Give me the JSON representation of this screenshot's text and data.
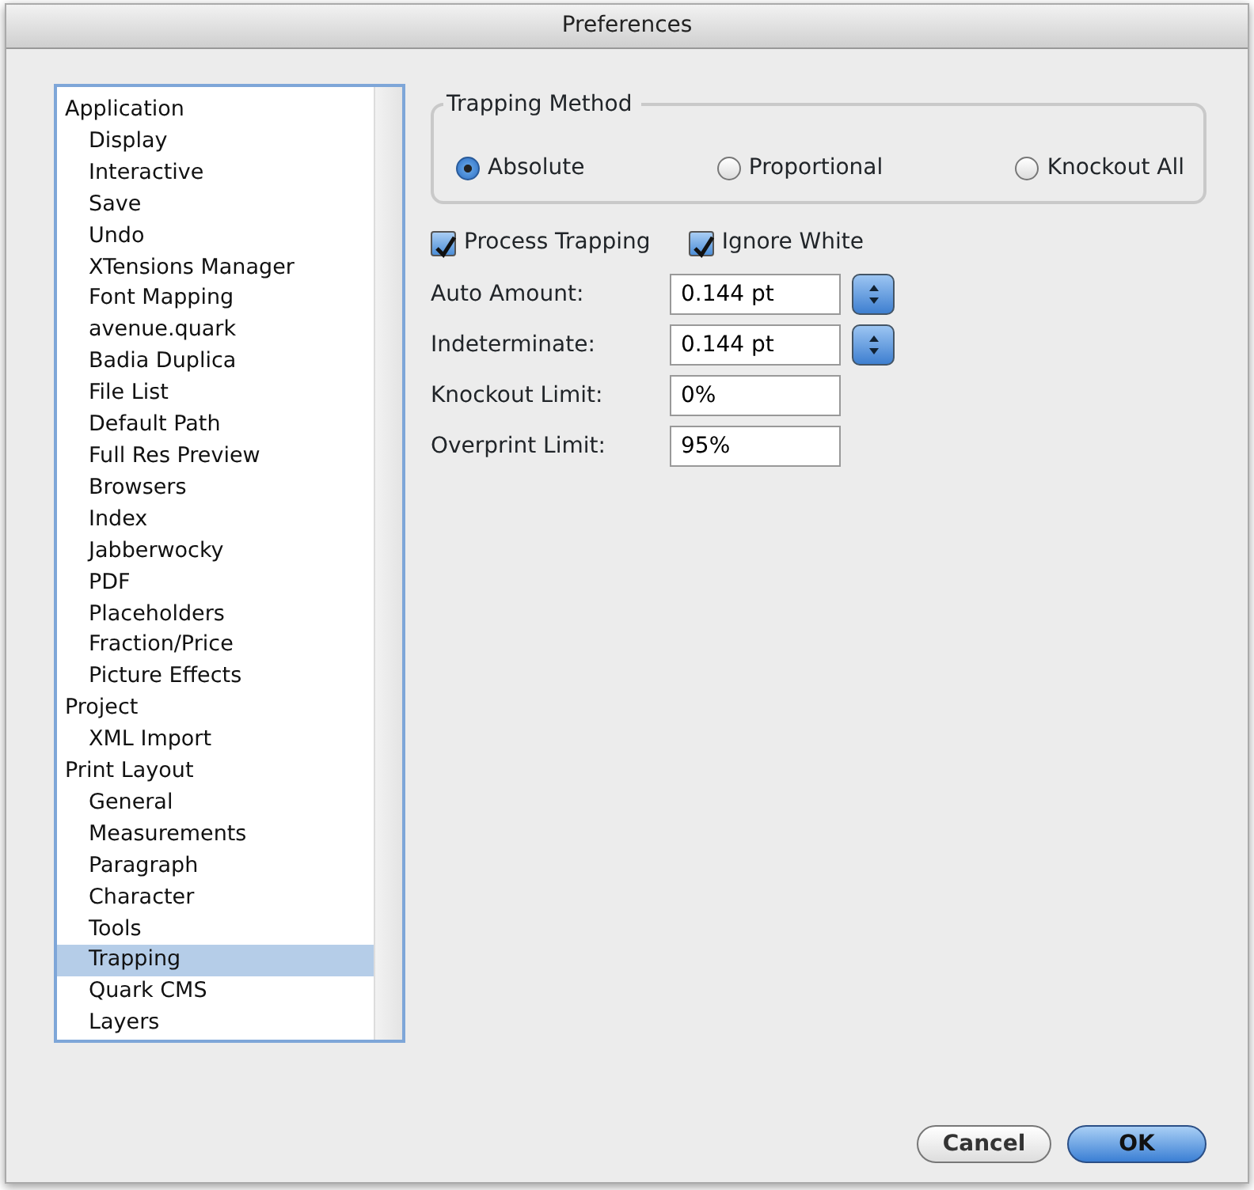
{
  "window": {
    "title": "Preferences"
  },
  "sidebar": {
    "items": [
      {
        "label": "Application",
        "selected": false,
        "children": [
          {
            "label": "Display",
            "selected": false
          },
          {
            "label": "Interactive",
            "selected": false
          },
          {
            "label": "Save",
            "selected": false
          },
          {
            "label": "Undo",
            "selected": false
          },
          {
            "label": "XTensions Manager",
            "selected": false
          },
          {
            "label": "Font Mapping",
            "selected": false
          },
          {
            "label": "avenue.quark",
            "selected": false
          },
          {
            "label": "Badia Duplica",
            "selected": false
          },
          {
            "label": "File List",
            "selected": false
          },
          {
            "label": "Default Path",
            "selected": false
          },
          {
            "label": "Full Res Preview",
            "selected": false
          },
          {
            "label": "Browsers",
            "selected": false
          },
          {
            "label": "Index",
            "selected": false
          },
          {
            "label": "Jabberwocky",
            "selected": false
          },
          {
            "label": "PDF",
            "selected": false
          },
          {
            "label": "Placeholders",
            "selected": false
          },
          {
            "label": "Fraction/Price",
            "selected": false
          },
          {
            "label": "Picture Effects",
            "selected": false
          }
        ]
      },
      {
        "label": "Project",
        "selected": false,
        "children": [
          {
            "label": "XML Import",
            "selected": false
          }
        ]
      },
      {
        "label": "Print Layout",
        "selected": false,
        "children": [
          {
            "label": "General",
            "selected": false
          },
          {
            "label": "Measurements",
            "selected": false
          },
          {
            "label": "Paragraph",
            "selected": false
          },
          {
            "label": "Character",
            "selected": false
          },
          {
            "label": "Tools",
            "selected": false
          },
          {
            "label": "Trapping",
            "selected": true
          },
          {
            "label": "Quark CMS",
            "selected": false
          },
          {
            "label": "Layers",
            "selected": false
          }
        ]
      }
    ]
  },
  "trapping_method": {
    "title": "Trapping Method",
    "options": [
      {
        "label": "Absolute",
        "selected": true
      },
      {
        "label": "Proportional",
        "selected": false
      },
      {
        "label": "Knockout All",
        "selected": false
      }
    ]
  },
  "checkboxes": [
    {
      "label": "Process Trapping",
      "checked": true
    },
    {
      "label": "Ignore White",
      "checked": true
    }
  ],
  "fields": [
    {
      "kind": "stepper",
      "label": "Auto Amount:",
      "value": "0.144 pt"
    },
    {
      "kind": "stepper",
      "label": "Indeterminate:",
      "value": "0.144 pt"
    },
    {
      "kind": "plain",
      "label": "Knockout Limit:",
      "value": "0%"
    },
    {
      "kind": "plain",
      "label": "Overprint Limit:",
      "value": "95%"
    }
  ],
  "buttons": [
    {
      "label": "Cancel",
      "kind": "normal"
    },
    {
      "label": "OK",
      "kind": "default"
    }
  ]
}
